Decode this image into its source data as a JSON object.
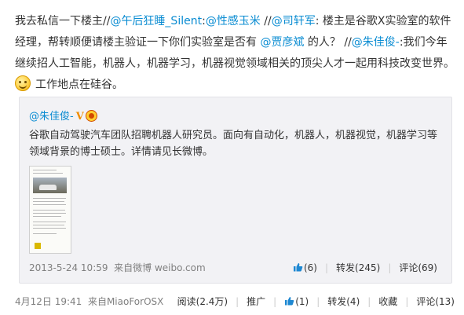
{
  "post": {
    "segments": [
      {
        "t": "我去私信一下楼主//"
      },
      {
        "t": "@午后狂睡_Silent",
        "link": true
      },
      {
        "t": ":"
      },
      {
        "t": "@性感玉米",
        "link": true
      },
      {
        "t": " //"
      },
      {
        "t": "@司轩军",
        "link": true
      },
      {
        "t": ": 楼主是谷歌X实验室的软件经理，帮转顺便请楼主验证一下你们实验室是否有 "
      },
      {
        "t": "@贾彦斌",
        "link": true
      },
      {
        "t": " 的人？ //"
      },
      {
        "t": "@朱佳俊-",
        "link": true
      },
      {
        "t": ":我们今年继续招人工智能，机器人，机器学习，机器视觉领域相关的顶尖人才一起用科技改变世界。"
      }
    ],
    "emoji_icon": "smile-emoji",
    "tail": "工作地点在硅谷。"
  },
  "quoted": {
    "author": "@朱佳俊-",
    "verified_badge": "V",
    "text": "谷歌自动驾驶汽车团队招聘机器人研究员。面向有自动化，机器人，机器视觉，机器学习等领域背景的博士硕士。详情请见长微博。",
    "timestamp": "2013-5-24 10:59",
    "source": "来自微博 weibo.com",
    "likes": "(6)",
    "repost": "转发(245)",
    "comment": "评论(69)"
  },
  "footer": {
    "timestamp": "4月12日 19:41",
    "source": "来自MiaoForOSX",
    "reads": "阅读(2.4万)",
    "promote": "推广",
    "likes": "(1)",
    "repost": "转发(4)",
    "favorite": "收藏",
    "comment": "评论(13)"
  },
  "colors": {
    "link": "#0a8cd2",
    "quote_bg": "#f2f2f5",
    "muted": "#808080"
  }
}
